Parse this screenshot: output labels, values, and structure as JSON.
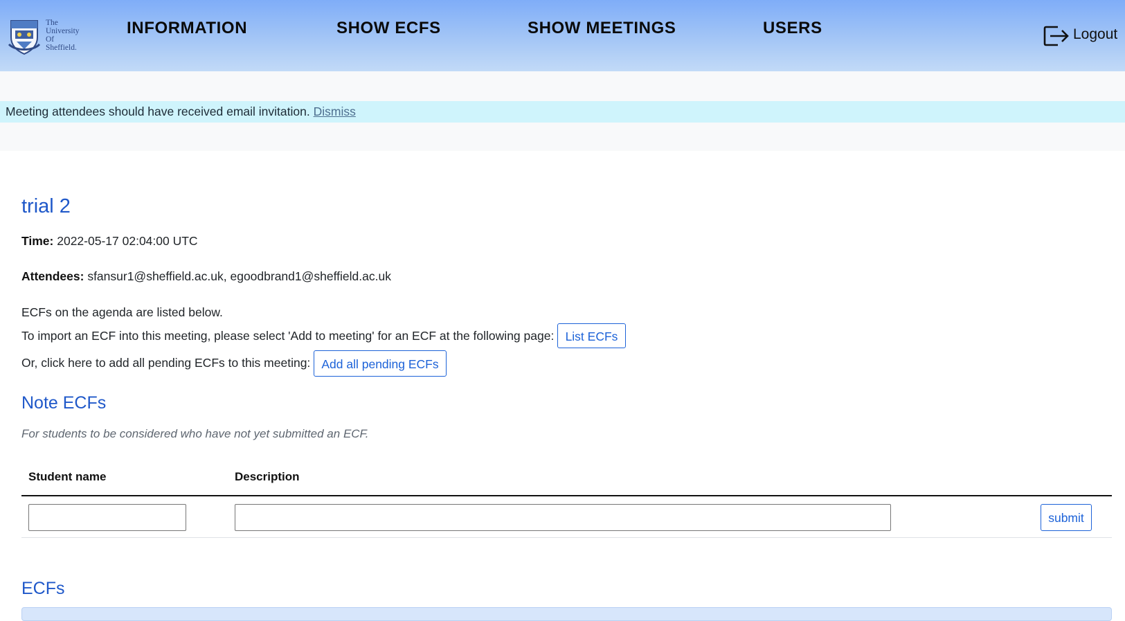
{
  "brand": {
    "logo_lines": [
      "The",
      "University",
      "Of",
      "Sheffield."
    ],
    "colors": {
      "nav_top": "#7fadf8",
      "nav_bottom": "#c2daf7",
      "accent": "#1f58c9",
      "alert_bg": "#cff4fc"
    }
  },
  "nav": {
    "items": [
      {
        "label": "INFORMATION"
      },
      {
        "label": "SHOW ECFS"
      },
      {
        "label": "SHOW MEETINGS"
      },
      {
        "label": "USERS"
      }
    ],
    "logout_label": "Logout",
    "logout_icon": "logout-icon"
  },
  "alert": {
    "message": "Meeting attendees should have received email invitation.",
    "dismiss_label": "Dismiss"
  },
  "meeting": {
    "title": "trial 2",
    "time_label": "Time:",
    "time_value": "2022-05-17 02:04:00 UTC",
    "attendees_label": "Attendees:",
    "attendees_value": "sfansur1@sheffield.ac.uk, egoodbrand1@sheffield.ac.uk",
    "agenda_text": "ECFs on the agenda are listed below.",
    "import_text": "To import an ECF into this meeting, please select 'Add to meeting' for an ECF at the following page:",
    "list_ecfs_label": "List ECFs",
    "add_all_text": "Or, click here to add all pending ECFs to this meeting:",
    "add_all_label": "Add all pending ECFs"
  },
  "note_ecfs": {
    "heading": "Note ECFs",
    "subtitle": "For students to be considered who have not yet submitted an ECF.",
    "columns": [
      "Student name",
      "Description"
    ],
    "student_name_value": "",
    "description_value": "",
    "submit_label": "submit"
  },
  "ecfs": {
    "heading": "ECFs"
  }
}
